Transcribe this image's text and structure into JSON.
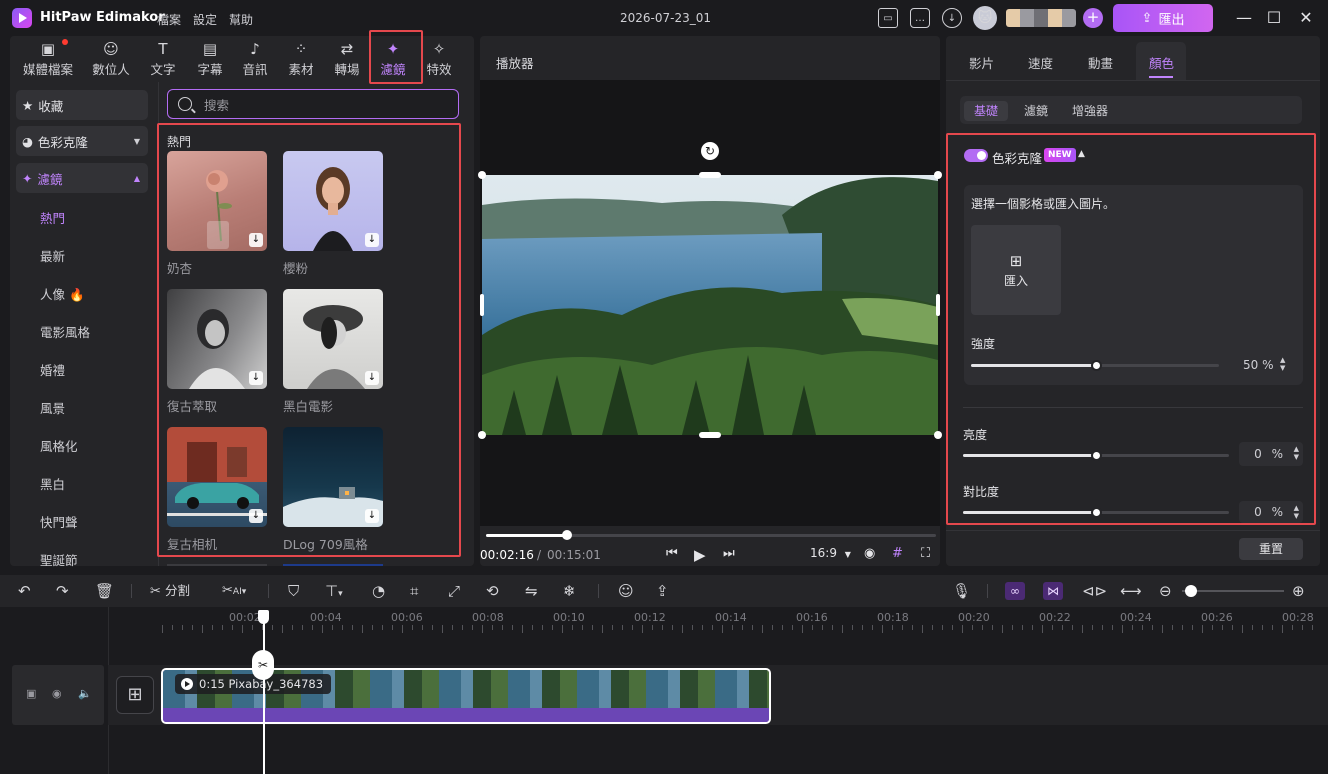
{
  "app": {
    "name": "HitPaw Edimakor",
    "menu": [
      "檔案",
      "設定",
      "幫助"
    ],
    "doc_title": "2026-07-23_01",
    "export_label": "匯出"
  },
  "categories": [
    {
      "label": "媒體檔案",
      "icon": "media-icon"
    },
    {
      "label": "數位人",
      "icon": "avatar-icon"
    },
    {
      "label": "文字",
      "icon": "text-icon"
    },
    {
      "label": "字幕",
      "icon": "subtitle-icon"
    },
    {
      "label": "音訊",
      "icon": "music-icon"
    },
    {
      "label": "素材",
      "icon": "sticker-icon"
    },
    {
      "label": "轉場",
      "icon": "transition-icon"
    },
    {
      "label": "濾鏡",
      "icon": "filter-icon"
    },
    {
      "label": "特效",
      "icon": "effect-icon"
    }
  ],
  "sidebar": {
    "favorites": "收藏",
    "color_clone": "色彩克隆",
    "filters": "濾鏡",
    "sub_items": [
      "熱門",
      "最新",
      "人像",
      "電影風格",
      "婚禮",
      "風景",
      "風格化",
      "黑白",
      "快門聲",
      "聖誕節"
    ]
  },
  "search": {
    "placeholder": "搜索"
  },
  "filters_section": {
    "label": "熱門",
    "items": [
      {
        "name": "奶杏"
      },
      {
        "name": "櫻粉"
      },
      {
        "name": "復古萃取"
      },
      {
        "name": "黑白電影"
      },
      {
        "name": "复古相机"
      },
      {
        "name": "DLog 709風格"
      }
    ]
  },
  "player": {
    "title": "播放器",
    "current_time": "00:02:16",
    "separator": "/",
    "total_time": "00:15:01",
    "aspect": "16:9",
    "progress_fraction": 0.18
  },
  "right_panel": {
    "tabs": [
      "影片",
      "速度",
      "動畫",
      "顏色"
    ],
    "sub_tabs": [
      "基礎",
      "濾鏡",
      "增強器"
    ],
    "color_clone_label": "色彩克隆",
    "new_badge": "NEW",
    "choose_text": "選擇一個影格或匯入圖片。",
    "import_label": "匯入",
    "intensity_label": "強度",
    "intensity_value": "50",
    "intensity_unit": "%",
    "brightness_label": "亮度",
    "brightness_value": "0",
    "brightness_unit": "%",
    "contrast_label": "對比度",
    "contrast_value": "0",
    "contrast_unit": "%",
    "reset_label": "重置"
  },
  "timeline_toolbar": {
    "split_label": "分割"
  },
  "timeline": {
    "ruler": [
      "00:02",
      "00:04",
      "00:06",
      "00:08",
      "00:10",
      "00:12",
      "00:14",
      "00:16",
      "00:18",
      "00:20",
      "00:22",
      "00:24",
      "00:26",
      "00:28"
    ],
    "clip_label": "0:15 Pixabay_364783"
  },
  "colors": {
    "accent": "#c084fc",
    "highlight": "#e5484d"
  }
}
